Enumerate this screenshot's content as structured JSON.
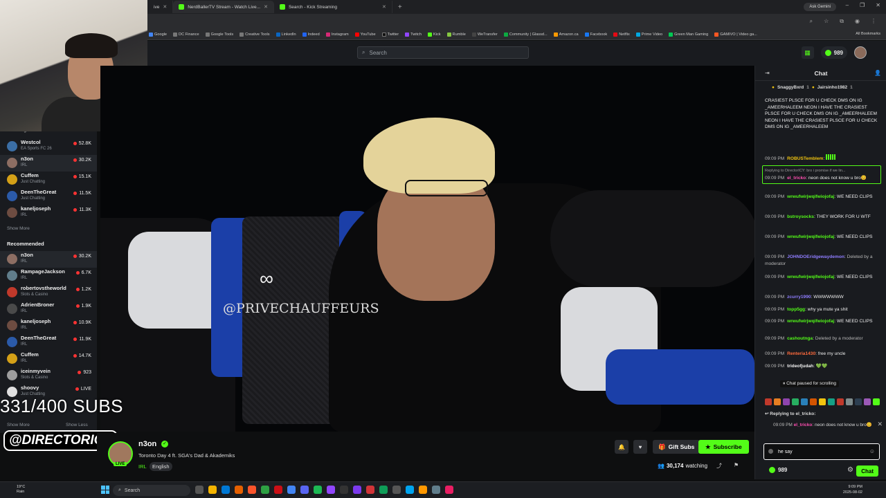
{
  "browser": {
    "tabs": [
      {
        "label": "ive",
        "active": false
      },
      {
        "label": "NerdBallerTV Stream - Watch Live...",
        "active": true
      },
      {
        "label": "Search - Kick Streaming",
        "active": false
      }
    ],
    "ask_gemini": "Ask Gemini",
    "bookmarks": [
      "Google",
      "DC Finance",
      "Google Tools",
      "Creative Tools",
      "LinkedIn",
      "Indeed",
      "Instagram",
      "YouTube",
      "Twitter",
      "Twitch",
      "Kick",
      "Rumble",
      "WeTransfer",
      "Community | Glassd...",
      "Amazon.ca",
      "Facebook",
      "Netflix",
      "Prime Video",
      "Green Man Gaming",
      "GAMIVO | Video ga..."
    ],
    "all_bookmarks": "All Bookmarks"
  },
  "topnav": {
    "search_placeholder": "Search",
    "kicks_count": "989"
  },
  "sidebar": {
    "following_label": "Following",
    "following": [
      {
        "name": "Westcol",
        "category": "EA Sports FC 26",
        "viewers": "52.8K",
        "color": "#3b6ea5"
      },
      {
        "name": "n3on",
        "category": "IRL",
        "viewers": "30.2K",
        "color": "#8d6e63",
        "selected": true
      },
      {
        "name": "Cuffem",
        "category": "Just Chatting",
        "viewers": "15.1K",
        "color": "#d4a017"
      },
      {
        "name": "DeenTheGreat",
        "category": "Just Chatting",
        "viewers": "11.5K",
        "color": "#2b5aa8"
      },
      {
        "name": "kaneljoseph",
        "category": "IRL",
        "viewers": "11.3K",
        "color": "#6d4c41"
      }
    ],
    "show_more_1": "Show More",
    "recommended_label": "Recommended",
    "recommended": [
      {
        "name": "n3on",
        "category": "IRL",
        "viewers": "30.2K",
        "color": "#8d6e63",
        "selected": true
      },
      {
        "name": "RampageJackson",
        "category": "IRL",
        "viewers": "6.7K",
        "color": "#607d8b"
      },
      {
        "name": "robertovstheworld",
        "category": "Slots & Casino",
        "viewers": "1.2K",
        "color": "#c0392b"
      },
      {
        "name": "AdrienBroner",
        "category": "IRL",
        "viewers": "1.9K",
        "color": "#4a4a4a"
      },
      {
        "name": "kaneljoseph",
        "category": "IRL",
        "viewers": "10.9K",
        "color": "#6d4c41"
      },
      {
        "name": "DeenTheGreat",
        "category": "IRL",
        "viewers": "11.9K",
        "color": "#2b5aa8"
      },
      {
        "name": "Cuffem",
        "category": "IRL",
        "viewers": "14.7K",
        "color": "#d4a017"
      },
      {
        "name": "iceinmyvein",
        "category": "Slots & Casino",
        "viewers": "923",
        "color": "#9e9e9e"
      },
      {
        "name": "shoovy",
        "category": "Just Chatting",
        "viewers": "LIVE",
        "color": "#e0e0e0"
      }
    ],
    "show_more_2": "Show More",
    "show_less": "Show Less"
  },
  "overlay": {
    "subs": "331/400 SUBS",
    "handle": "@DIRECTORICY"
  },
  "video": {
    "watermark": "@PRIVECHAUFFEURS",
    "logo": "∞"
  },
  "stream": {
    "channel": "n3on",
    "live_badge": "LIVE",
    "title": "Toronto Day 4 ft. SGA's Dad & Akademiks",
    "tag_category": "IRL",
    "tag_language": "English",
    "gift_label": "Gift Subs",
    "subscribe_label": "Subscribe",
    "viewers": "30,174",
    "viewers_suffix": "watching"
  },
  "chat": {
    "title": "Chat",
    "pinned": [
      {
        "name": "SnaggyBxrd",
        "count": "1"
      },
      {
        "name": "Jairsinho1982",
        "count": "1"
      }
    ],
    "messages": [
      {
        "time": "",
        "user": "",
        "user_color": "#eee",
        "text": "CRASIEST PLSCE FOR U CHECK DMS ON IG _AMEERHALEEM NEON I HAVE THE CRASIEST PLSCE FOR U CHECK DMS ON IG _AMEERHALEEM NEON I HAVE THE CRASIEST PLSCE FOR U CHECK DMS ON IG _AMEERHALEEM"
      },
      {
        "time": "09:09 PM",
        "user": "ROBUSTemblem",
        "user_color": "#f1c40f",
        "text": ""
      },
      {
        "time": "09:09 PM",
        "user": "el_tricko",
        "user_color": "#ff4fb1",
        "text": "neon does not know u bro😊",
        "reply_header": "Replying to DirectorICY: bro i promise if we lin..."
      },
      {
        "time": "09:09 PM",
        "user": "wrwufwirjwqifwiojofaj",
        "user_color": "#53fc18",
        "text": "WE NEED CLIPS"
      },
      {
        "time": "09:09 PM",
        "user": "bstroysocks",
        "user_color": "#53fc18",
        "text": "THEY WORK FOR U WTF"
      },
      {
        "time": "09:09 PM",
        "user": "wrwufwirjwqifwiojofaj",
        "user_color": "#53fc18",
        "text": "WE NEED CLIPS"
      },
      {
        "time": "09:09 PM",
        "user": "JOHNDOEridgewaydemon",
        "user_color": "#8f7dff",
        "text": "Deleted by a moderator",
        "deleted": true
      },
      {
        "time": "09:09 PM",
        "user": "wrwufwirjwqifwiojofaj",
        "user_color": "#53fc18",
        "text": "WE NEED CLIPS"
      },
      {
        "time": "09:09 PM",
        "user": "zcurry1990",
        "user_color": "#8f7dff",
        "text": "WWWWWWW"
      },
      {
        "time": "09:09 PM",
        "user": "topp5gg",
        "user_color": "#53fc18",
        "text": "why ya mute ya shit"
      },
      {
        "time": "09:09 PM",
        "user": "wrwufwirjwqifwiojofaj",
        "user_color": "#53fc18",
        "text": "WE NEED CLIPS"
      },
      {
        "time": "09:09 PM",
        "user": "cashoutnga",
        "user_color": "#53fc18",
        "text": "Deleted by a moderator",
        "deleted": true
      },
      {
        "time": "09:09 PM",
        "user": "Renteria1430",
        "user_color": "#ff6b3d",
        "text": "free my uncle"
      },
      {
        "time": "09:09 PM",
        "user": "trideofjudah",
        "user_color": "#f2f2f2",
        "text": "💚💚"
      }
    ],
    "paused": "Chat paused for scrolling",
    "replying_to": "Replying to el_tricko:",
    "reply_quote_time": "09:09 PM",
    "reply_quote_user": "el_tricko",
    "reply_quote_text": "neon does not know u bro😊",
    "input_value": "he say",
    "kicks": "989",
    "send_label": "Chat"
  },
  "taskbar": {
    "temp": "19°C",
    "weather": "Rain",
    "search": "Search",
    "time": "9:09 PM",
    "date": "2025-08-02"
  }
}
